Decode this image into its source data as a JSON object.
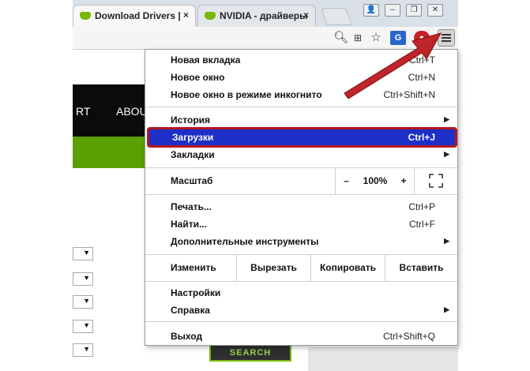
{
  "browser": {
    "tabs": [
      {
        "title": "Download Drivers |",
        "close": "×"
      },
      {
        "title": "NVIDIA - драйверы",
        "close": "×"
      }
    ]
  },
  "page": {
    "nav_items": [
      "RT",
      "ABOU"
    ],
    "search_label": "SEARCH",
    "select_arrow": "▼"
  },
  "menu": {
    "items": [
      {
        "label": "Новая вкладка",
        "shortcut": "Ctrl+T"
      },
      {
        "label": "Новое окно",
        "shortcut": "Ctrl+N"
      },
      {
        "label": "Новое окно в режиме инкогнито",
        "shortcut": "Ctrl+Shift+N"
      },
      {
        "label": "История",
        "arrow": "▶"
      },
      {
        "label": "Загрузки",
        "shortcut": "Ctrl+J"
      },
      {
        "label": "Закладки",
        "arrow": "▶"
      },
      {
        "label": "Печать...",
        "shortcut": "Ctrl+P"
      },
      {
        "label": "Найти...",
        "shortcut": "Ctrl+F"
      },
      {
        "label": "Дополнительные инструменты",
        "arrow": "▶"
      },
      {
        "label": "Настройки"
      },
      {
        "label": "Справка",
        "arrow": "▶"
      },
      {
        "label": "Выход",
        "shortcut": "Ctrl+Shift+Q"
      }
    ],
    "zoom": {
      "label": "Масштаб",
      "minus": "–",
      "value": "100%",
      "plus": "+"
    },
    "edit": {
      "label": "Изменить",
      "cut": "Вырезать",
      "copy": "Копировать",
      "paste": "Вставить"
    }
  },
  "colors": {
    "highlight": "#1c2fc9",
    "highlight_border": "#b5161b",
    "arrow": "#c4161c"
  }
}
